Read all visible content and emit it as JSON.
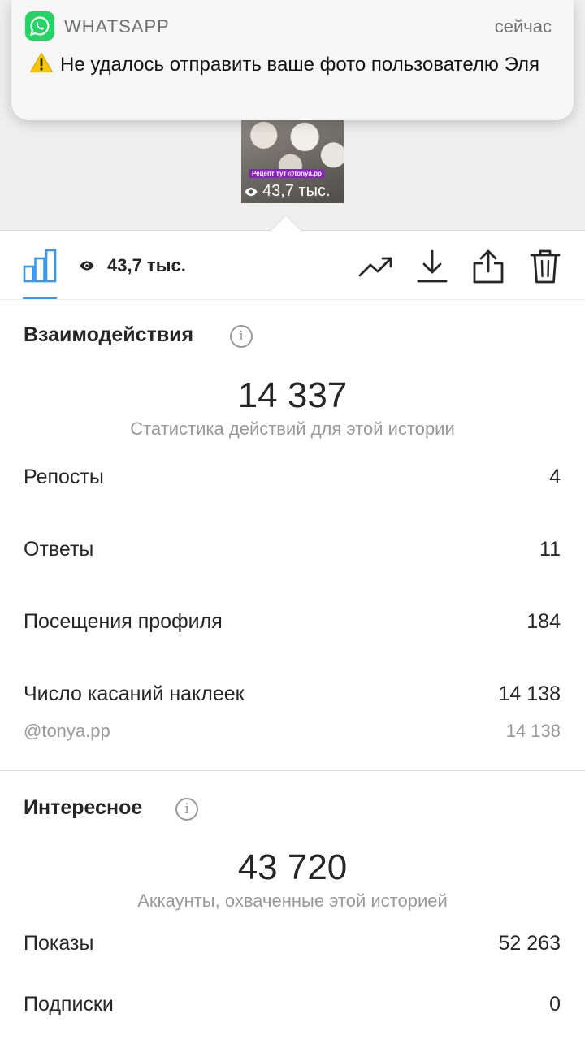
{
  "notification": {
    "app_name": "WHATSAPP",
    "time": "сейчас",
    "message": "Не удалось отправить ваше фото пользователю Эля",
    "app_icon": "whatsapp-icon",
    "warning_icon": "warning-icon"
  },
  "story_thumbnail": {
    "sticker_text": "Рецепт тут @tonya.pp",
    "views": "43,7 тыс."
  },
  "toolbar": {
    "views": "43,7 тыс.",
    "icons": [
      "bar-chart-icon",
      "eye-icon",
      "trend-icon",
      "download-icon",
      "share-icon",
      "trash-icon"
    ]
  },
  "interactions": {
    "title": "Взаимодействия",
    "total": "14 337",
    "caption": "Статистика действий для этой истории",
    "rows": [
      {
        "label": "Репосты",
        "value": "4"
      },
      {
        "label": "Ответы",
        "value": "11"
      },
      {
        "label": "Посещения профиля",
        "value": "184"
      },
      {
        "label": "Число касаний наклеек",
        "value": "14 138"
      }
    ],
    "sub_row": {
      "label": "@tonya.pp",
      "value": "14 138"
    }
  },
  "discovery": {
    "title": "Интересное",
    "total": "43 720",
    "caption": "Аккаунты, охваченные этой историей",
    "rows": [
      {
        "label": "Показы",
        "value": "52 263"
      },
      {
        "label": "Подписки",
        "value": "0"
      }
    ]
  },
  "colors": {
    "accent": "#3897f0",
    "whatsapp": "#25d366",
    "sticker": "#8a1fc2",
    "muted": "#999999"
  }
}
